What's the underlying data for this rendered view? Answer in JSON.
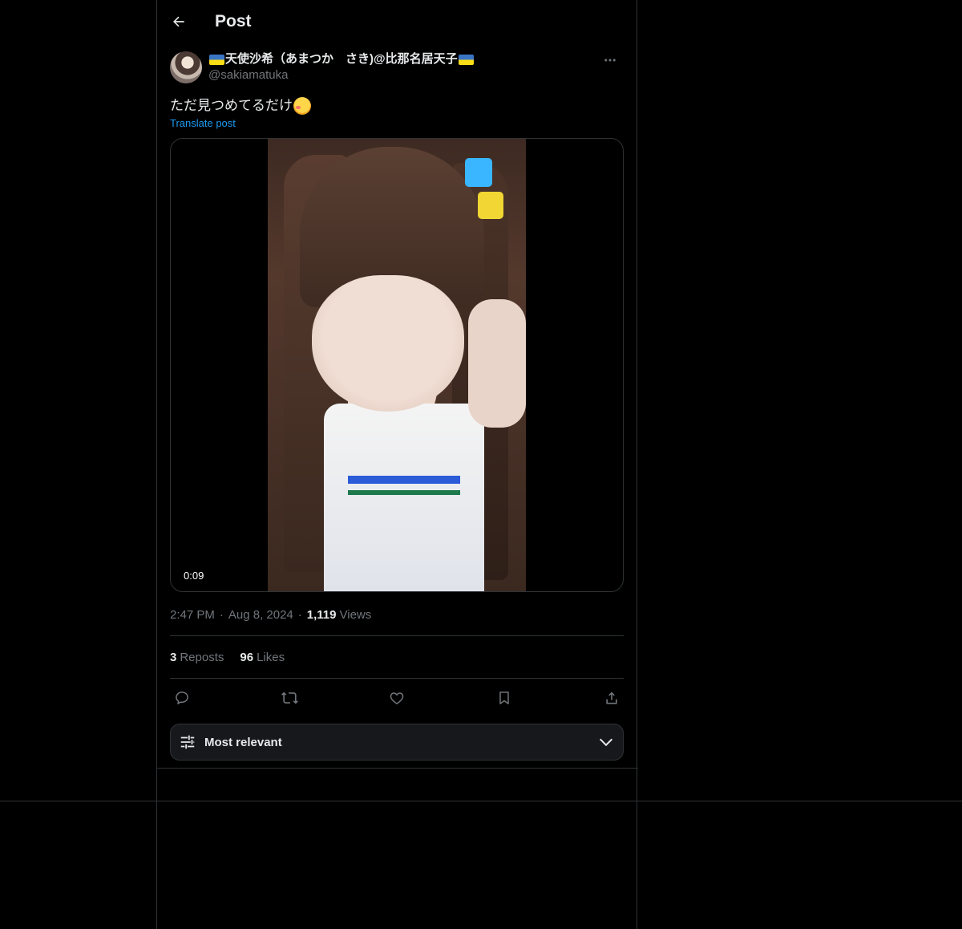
{
  "header": {
    "title": "Post",
    "back_icon": "arrow-left-icon"
  },
  "post": {
    "author": {
      "name_prefix_flag": "ukraine-flag",
      "display_name": "天使沙希（あまつか　さき)@比那名居天子",
      "name_suffix_flag": "ukraine-flag",
      "handle": "@sakiamatuka"
    },
    "text": "ただ見つめてるだけ",
    "text_emoji": "smiling-face-with-hearts",
    "translate_label": "Translate post",
    "video": {
      "duration": "0:09"
    },
    "time": "2:47 PM",
    "date": "Aug 8, 2024",
    "views_count": "1,119",
    "views_label": "Views",
    "reposts_count": "3",
    "reposts_label": "Reposts",
    "likes_count": "96",
    "likes_label": "Likes"
  },
  "actions": {
    "icons": [
      "reply-icon",
      "repost-icon",
      "like-icon",
      "bookmark-icon",
      "share-icon"
    ]
  },
  "sort": {
    "label": "Most relevant"
  },
  "colors": {
    "background": "#000000",
    "text": "#e7e9ea",
    "muted": "#71767b",
    "accent": "#1d9bf0",
    "border": "#2f3336"
  }
}
